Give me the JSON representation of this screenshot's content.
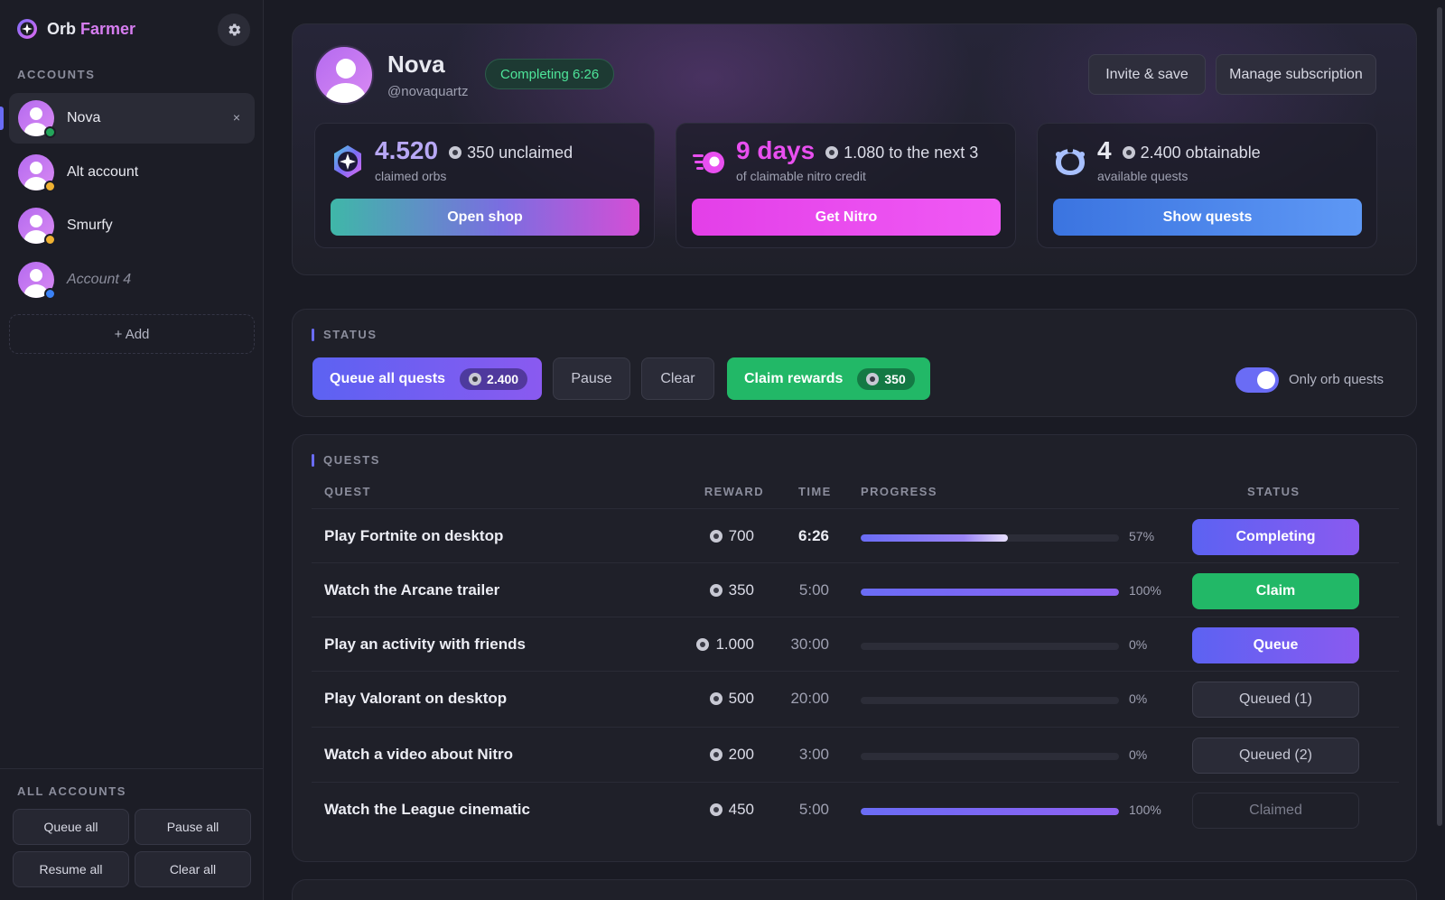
{
  "app": {
    "brand_part1": "Orb",
    "brand_part2": "Farmer"
  },
  "sidebar": {
    "accounts_label": "ACCOUNTS",
    "accounts": [
      {
        "name": "Nova",
        "status_color": "#23a55a",
        "active": true
      },
      {
        "name": "Alt account",
        "status_color": "#f0b232"
      },
      {
        "name": "Smurfy",
        "status_color": "#f0b232"
      },
      {
        "name": "Account 4",
        "status_color": "#3b82f6",
        "muted": true
      }
    ],
    "close_symbol": "×",
    "add_label": "+ Add",
    "all_accounts_label": "ALL ACCOUNTS",
    "queue_all": "Queue all",
    "pause_all": "Pause all",
    "resume_all": "Resume all",
    "clear_all": "Clear all"
  },
  "profile": {
    "name": "Nova",
    "handle": "@novaquartz",
    "status_pill": "Completing 6:26",
    "invite_label": "Invite & save",
    "manage_label": "Manage subscription"
  },
  "stats": {
    "orbs": {
      "value": "4.520",
      "extra": "350 unclaimed",
      "sub": "claimed orbs",
      "button": "Open shop"
    },
    "nitro": {
      "value": "9 days",
      "extra": "1.080 to the next 3",
      "sub": "of claimable nitro credit",
      "button": "Get Nitro"
    },
    "quests": {
      "value": "4",
      "extra": "2.400 obtainable",
      "sub": "available quests",
      "button": "Show quests"
    }
  },
  "status_panel": {
    "title": "STATUS",
    "queue_all_label": "Queue all quests",
    "queue_all_count": "2.400",
    "pause_label": "Pause",
    "clear_label": "Clear",
    "claim_label": "Claim rewards",
    "claim_count": "350",
    "toggle_label": "Only orb quests",
    "toggle_on": true
  },
  "quests": {
    "title": "QUESTS",
    "headers": {
      "quest": "QUEST",
      "reward": "REWARD",
      "time": "TIME",
      "progress": "PROGRESS",
      "status": "STATUS"
    },
    "rows": [
      {
        "name": "Play Fortnite on desktop",
        "reward": "700",
        "time": "6:26",
        "progress": 0.57,
        "progress_label": "57%",
        "status": "Completing",
        "kind": "completing"
      },
      {
        "name": "Watch the Arcane trailer",
        "reward": "350",
        "time": "5:00",
        "progress": 1.0,
        "progress_label": "100%",
        "status": "Claim",
        "kind": "claim"
      },
      {
        "name": "Play an activity with friends",
        "reward": "1.000",
        "time": "30:00",
        "progress": 0,
        "progress_label": "0%",
        "status": "Queue",
        "kind": "queue"
      },
      {
        "name": "Play Valorant on desktop",
        "reward": "500",
        "time": "20:00",
        "progress": 0,
        "progress_label": "0%",
        "status": "Queued (1)",
        "kind": "queued"
      },
      {
        "name": "Watch a video about Nitro",
        "reward": "200",
        "time": "3:00",
        "progress": 0,
        "progress_label": "0%",
        "status": "Queued (2)",
        "kind": "queued"
      },
      {
        "name": "Watch the League cinematic",
        "reward": "450",
        "time": "5:00",
        "progress": 1.0,
        "progress_label": "100%",
        "status": "Claimed",
        "kind": "claimed"
      }
    ]
  },
  "colors": {
    "accent": "#6a6cf5",
    "green": "#22b867",
    "pink": "#e94ff0",
    "blue": "#3b82f6"
  }
}
